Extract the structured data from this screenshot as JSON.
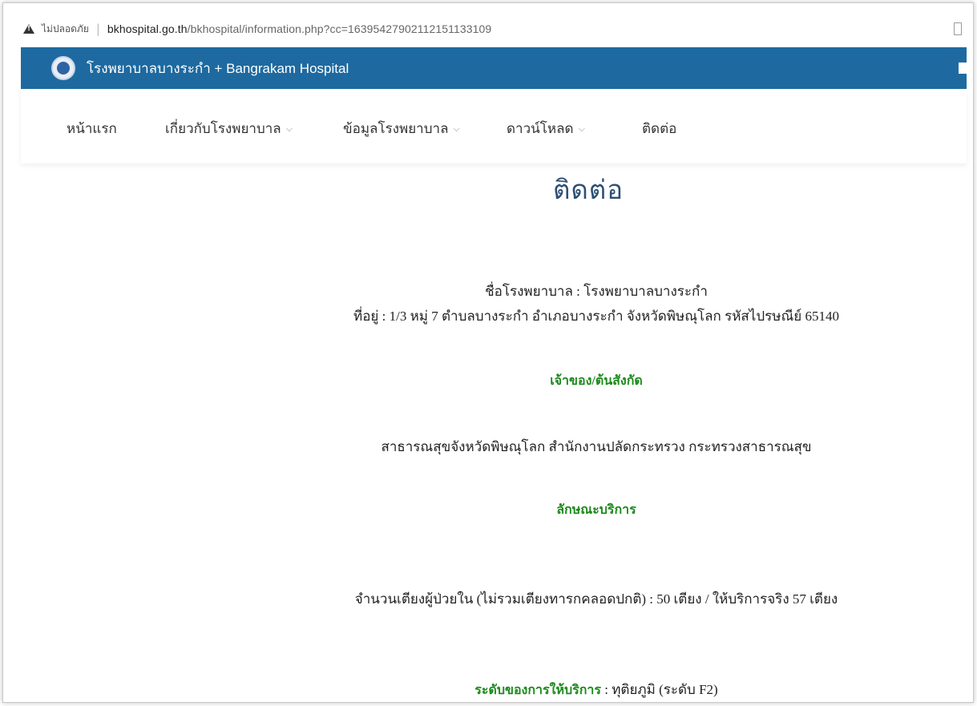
{
  "browser": {
    "security_label": "ไม่ปลอดภัย",
    "separator": "|",
    "url_host": "bkhospital.go.th",
    "url_path": "/bkhospital/information.php?cc=16395427902112151133109"
  },
  "header": {
    "site_title": "โรงพยาบาลบางระกำ + Bangrakam Hospital"
  },
  "nav": {
    "items": [
      {
        "label": "หน้าแรก",
        "has_dropdown": false
      },
      {
        "label": "เกี่ยวกับโรงพยาบาล",
        "has_dropdown": true
      },
      {
        "label": "ข้อมูลโรงพยาบาล",
        "has_dropdown": true
      },
      {
        "label": "ดาวน์โหลด",
        "has_dropdown": true
      },
      {
        "label": "ติดต่อ",
        "has_dropdown": false
      }
    ],
    "chevron": "⌵"
  },
  "page": {
    "title": "ติดต่อ",
    "hospital_name_line": "ชื่อโรงพยาบาล : โรงพยาบาลบางระกำ",
    "address_line": "ที่อยู่ : 1/3 หมู่ 7 ตำบลบางระกำ  อำเภอบางระกำ จังหวัดพิษณุโลก รหัสไปรษณีย์ 65140",
    "owner_heading": "เจ้าของ/ต้นสังกัด",
    "owner_text": "สาธารณสุขจังหวัดพิษณุโลก สำนักงานปลัดกระทรวง กระทรวงสาธารณสุข",
    "service_heading": "ลักษณะบริการ",
    "beds_line": "จำนวนเตียงผู้ป่วยใน (ไม่รวมเตียงทารกคลอดปกติ) :   50 เตียง / ให้บริการจริง 57 เตียง",
    "service_level_label": "ระดับของการให้บริการ",
    "service_level_value": " :  ทุติยภูมิ (ระดับ F2)"
  },
  "colors": {
    "header_bg": "#1e6aa0",
    "title": "#2d4f74",
    "heading_green": "#1c8a1c"
  }
}
